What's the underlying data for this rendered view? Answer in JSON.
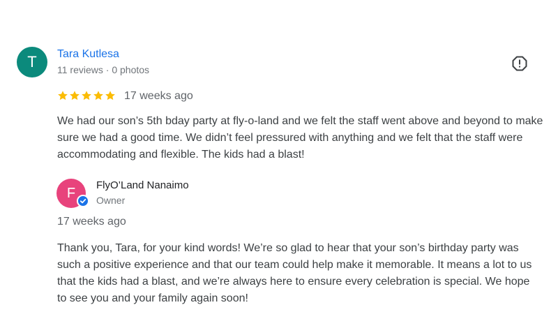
{
  "review": {
    "reviewer": {
      "initial": "T",
      "name": "Tara Kutlesa",
      "meta": "11 reviews · 0 photos",
      "avatar_color": "#0b8a7c"
    },
    "report_icon": "report-flag-icon",
    "rating": 5,
    "max_rating": 5,
    "star_color": "#fbbc04",
    "time": "17 weeks ago",
    "text": "We had our son’s 5th bday party at fly-o-land and we felt the staff went above and beyond to make sure we had a good time. We didn’t feel pressured with anything and we felt that the staff were accommodating and flexible. The kids had a blast!"
  },
  "owner_reply": {
    "initial": "F",
    "name": "FlyO’Land Nanaimo",
    "role": "Owner",
    "avatar_color": "#e8437c",
    "badge_icon": "verified-check-icon",
    "time": "17 weeks ago",
    "text": "Thank you, Tara, for your kind words! We’re so glad to hear that your son’s birthday party was such a positive experience and that our team could help make it memorable. It means a lot to us that the kids had a blast, and we’re always here to ensure every celebration is special. We hope to see you and your family again soon!"
  },
  "colors": {
    "link": "#1a73e8",
    "text": "#3c4043",
    "secondary": "#70757a"
  }
}
